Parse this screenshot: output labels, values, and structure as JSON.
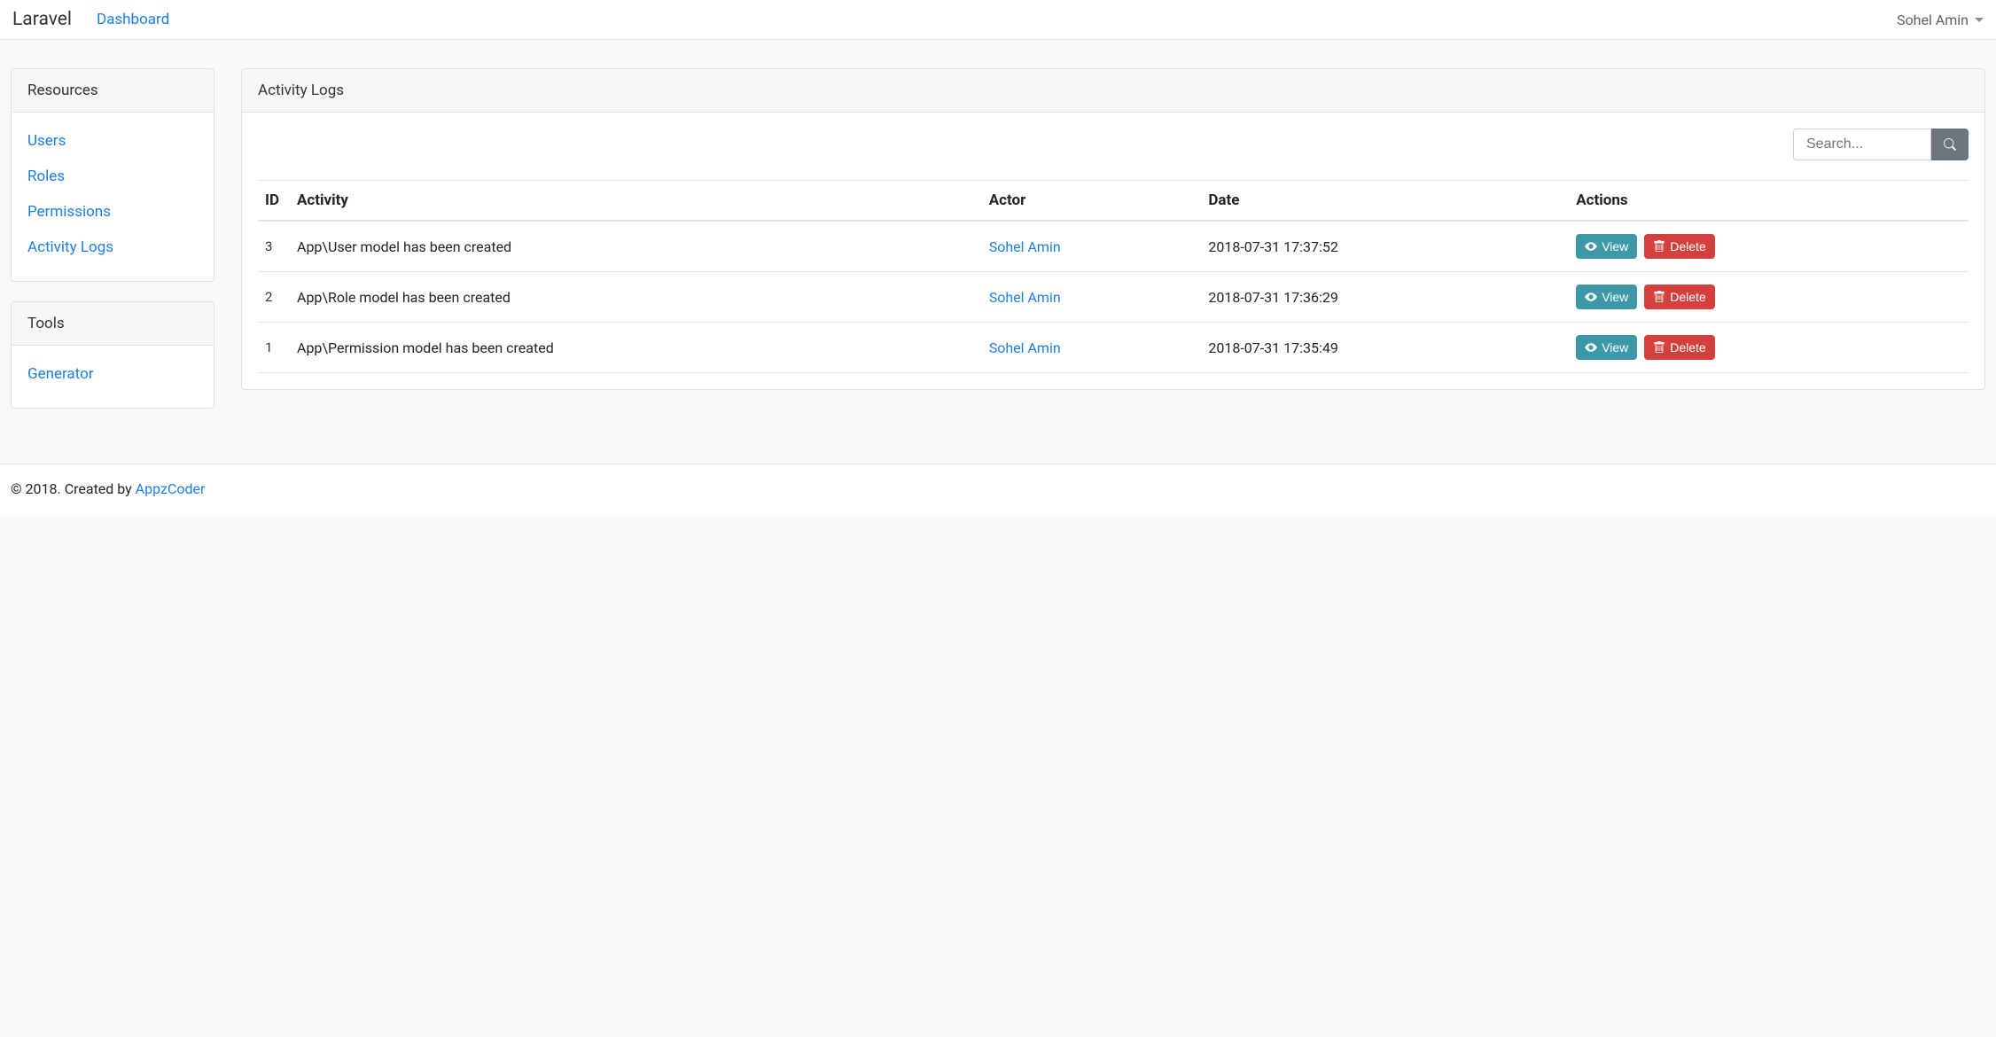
{
  "navbar": {
    "brand": "Laravel",
    "dashboard": "Dashboard",
    "user": "Sohel Amin"
  },
  "sidebar": {
    "resources_title": "Resources",
    "resources": [
      {
        "label": "Users"
      },
      {
        "label": "Roles"
      },
      {
        "label": "Permissions"
      },
      {
        "label": "Activity Logs"
      }
    ],
    "tools_title": "Tools",
    "tools": [
      {
        "label": "Generator"
      }
    ]
  },
  "main": {
    "title": "Activity Logs",
    "search_placeholder": "Search...",
    "columns": {
      "id": "ID",
      "activity": "Activity",
      "actor": "Actor",
      "date": "Date",
      "actions": "Actions"
    },
    "view_label": "View",
    "delete_label": "Delete",
    "rows": [
      {
        "id": "3",
        "activity": "App\\User model has been created",
        "actor": "Sohel Amin",
        "date": "2018-07-31 17:37:52"
      },
      {
        "id": "2",
        "activity": "App\\Role model has been created",
        "actor": "Sohel Amin",
        "date": "2018-07-31 17:36:29"
      },
      {
        "id": "1",
        "activity": "App\\Permission model has been created",
        "actor": "Sohel Amin",
        "date": "2018-07-31 17:35:49"
      }
    ]
  },
  "footer": {
    "text": "© 2018. Created by ",
    "link": "AppzCoder"
  }
}
